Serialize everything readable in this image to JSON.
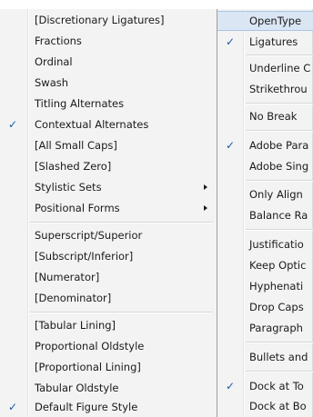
{
  "left_menu": {
    "items": [
      {
        "label": "[Discretionary Ligatures]",
        "checked": false
      },
      {
        "label": "Fractions",
        "checked": false
      },
      {
        "label": "Ordinal",
        "checked": false
      },
      {
        "label": "Swash",
        "checked": false
      },
      {
        "label": "Titling Alternates",
        "checked": false
      },
      {
        "label": "Contextual Alternates",
        "checked": true
      },
      {
        "label": "[All Small Caps]",
        "checked": false
      },
      {
        "label": "[Slashed Zero]",
        "checked": false
      },
      {
        "label": "Stylistic Sets",
        "checked": false,
        "submenu": true
      },
      {
        "label": "Positional Forms",
        "checked": false,
        "submenu": true
      },
      {
        "label": "Superscript/Superior",
        "checked": false
      },
      {
        "label": "[Subscript/Inferior]",
        "checked": false
      },
      {
        "label": "[Numerator]",
        "checked": false
      },
      {
        "label": "[Denominator]",
        "checked": false
      },
      {
        "label": "[Tabular Lining]",
        "checked": false
      },
      {
        "label": "Proportional Oldstyle",
        "checked": false
      },
      {
        "label": "[Proportional Lining]",
        "checked": false
      },
      {
        "label": "Tabular Oldstyle",
        "checked": false
      },
      {
        "label": "Default Figure Style",
        "checked": true
      }
    ]
  },
  "right_menu": {
    "items": [
      {
        "label": "OpenType",
        "checked": false,
        "highlighted": true
      },
      {
        "label": "Ligatures",
        "checked": true
      },
      {
        "label": "Underline C",
        "checked": false
      },
      {
        "label": "Strikethrou",
        "checked": false
      },
      {
        "label": "No Break",
        "checked": false
      },
      {
        "label": "Adobe Para",
        "checked": true
      },
      {
        "label": "Adobe Sing",
        "checked": false
      },
      {
        "label": "Only Align",
        "checked": false
      },
      {
        "label": "Balance Ra",
        "checked": false
      },
      {
        "label": "Justificatio",
        "checked": false
      },
      {
        "label": "Keep Optic",
        "checked": false
      },
      {
        "label": "Hyphenati",
        "checked": false
      },
      {
        "label": "Drop Caps",
        "checked": false
      },
      {
        "label": "Paragraph",
        "checked": false
      },
      {
        "label": "Bullets and",
        "checked": false
      },
      {
        "label": "Dock at To",
        "checked": true
      },
      {
        "label": "Dock at Bo",
        "checked": false
      }
    ]
  },
  "checkmark_glyph": "✓",
  "colors": {
    "check": "#1a5aa8",
    "highlight": "#dbe6f4"
  }
}
